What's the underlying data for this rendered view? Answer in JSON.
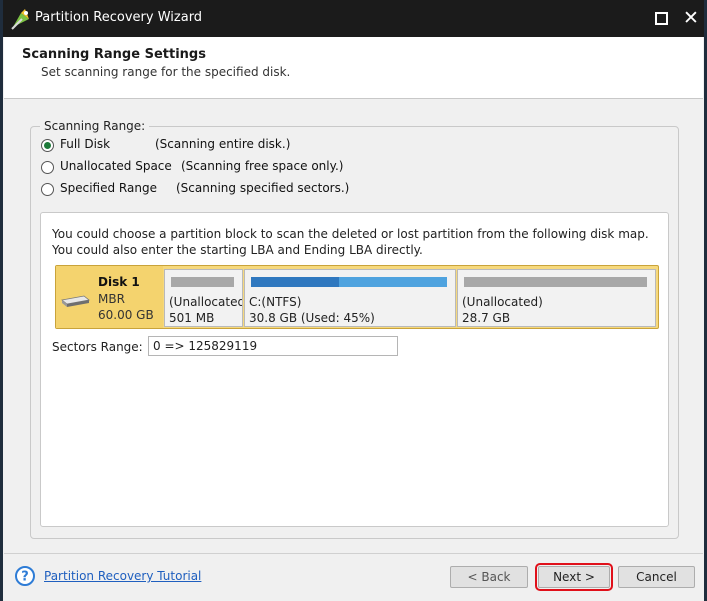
{
  "window": {
    "title": "Partition Recovery Wizard"
  },
  "header": {
    "title": "Scanning Range Settings",
    "subtitle": "Set scanning range for the specified disk."
  },
  "scanning_range": {
    "label": "Scanning Range:",
    "options": [
      {
        "label": "Full Disk",
        "description": "(Scanning entire disk.)",
        "selected": true
      },
      {
        "label": "Unallocated Space",
        "description": "(Scanning free space only.)",
        "selected": false
      },
      {
        "label": "Specified Range",
        "description": "(Scanning specified sectors.)",
        "selected": false
      }
    ]
  },
  "disk_map": {
    "description": "You could choose a partition block to scan the deleted or lost partition from the following disk map. You could also enter the starting LBA and Ending LBA directly.",
    "disk": {
      "name": "Disk 1",
      "type": "MBR",
      "size": "60.00 GB"
    },
    "partitions": [
      {
        "name": "(Unallocated)",
        "size": "501 MB",
        "used_fraction": 0
      },
      {
        "name": "C:(NTFS)",
        "size": "30.8 GB (Used: 45%)",
        "used_fraction": 0.45
      },
      {
        "name": "(Unallocated)",
        "size": "28.7 GB",
        "used_fraction": 0
      }
    ],
    "sectors_range": {
      "label": "Sectors Range:",
      "value": "0 => 125829119"
    }
  },
  "footer": {
    "tutorial_link": "Partition Recovery Tutorial",
    "back_label": "< Back",
    "next_label": "Next >",
    "cancel_label": "Cancel"
  },
  "colors": {
    "disk_selected": "#f6d97e",
    "used_bar": "#2f78bf",
    "free_bar": "#4fa3df",
    "unallocated_bar": "#a8a8a8",
    "highlight_outline": "#e0101a",
    "link": "#1f5fbf"
  }
}
